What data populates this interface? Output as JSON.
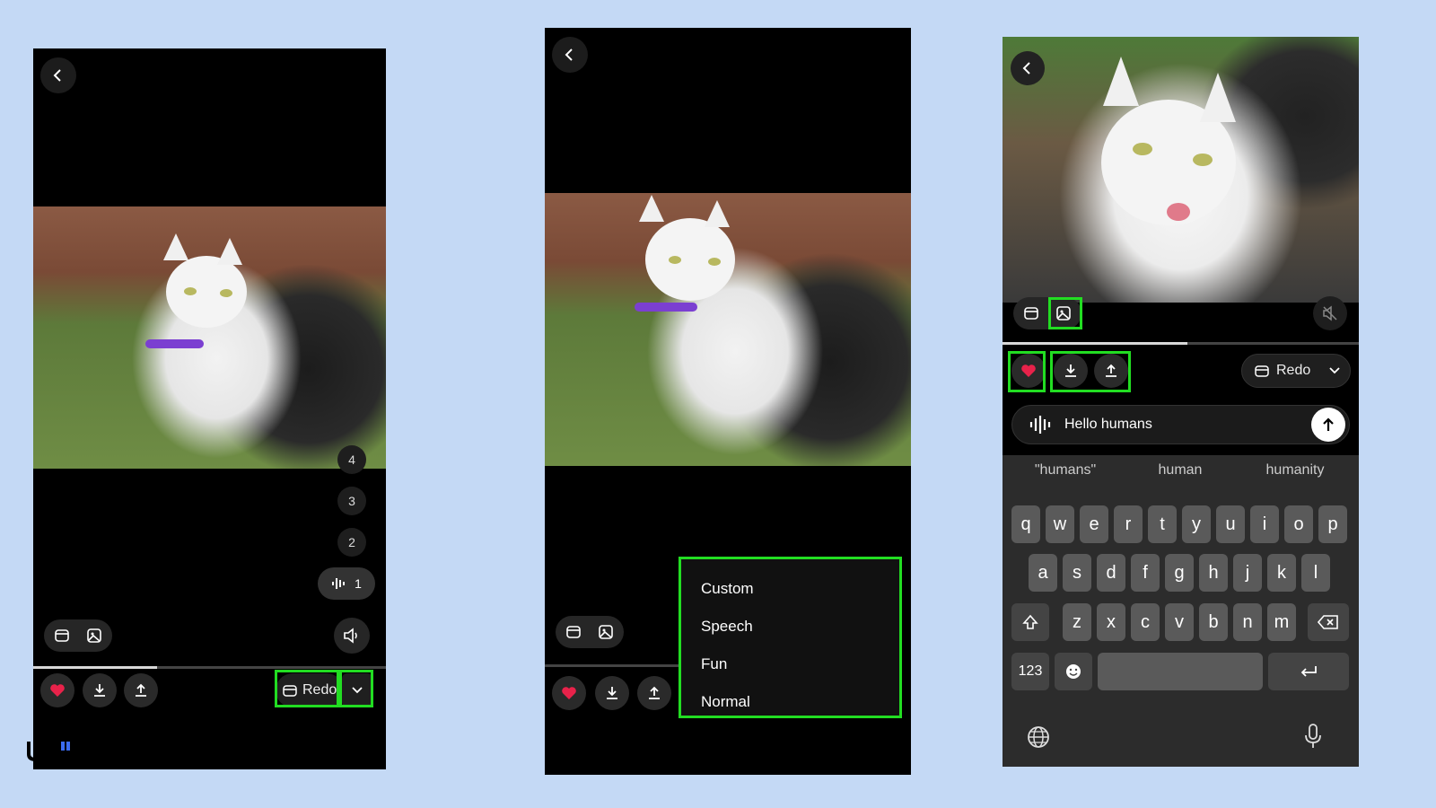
{
  "panel1": {
    "numbers": [
      "4",
      "3",
      "2",
      "1"
    ],
    "redo_label": "Redo",
    "progress": 0.35
  },
  "panel2": {
    "menu_items": [
      "Custom",
      "Speech",
      "Fun",
      "Normal"
    ]
  },
  "panel3": {
    "redo_label": "Redo",
    "input_text": "Hello humans",
    "suggestions": [
      "\"humans\"",
      "human",
      "humanity"
    ],
    "keyboard": {
      "row1": [
        "q",
        "w",
        "e",
        "r",
        "t",
        "y",
        "u",
        "i",
        "o",
        "p"
      ],
      "row2": [
        "a",
        "s",
        "d",
        "f",
        "g",
        "h",
        "j",
        "k",
        "l"
      ],
      "row3": [
        "z",
        "x",
        "c",
        "v",
        "b",
        "n",
        "m"
      ],
      "numbers_key": "123"
    },
    "progress": 0.52
  },
  "colors": {
    "background": "#c4d9f5",
    "highlight": "#22dd22",
    "heart": "#e8224a",
    "collar": "#7b3fd1"
  },
  "icons": [
    "back-chevron-icon",
    "heart-icon",
    "download-icon",
    "share-icon",
    "redo-icon",
    "chevron-down-icon",
    "clip-icon",
    "image-icon",
    "speaker-icon",
    "muted-speaker-icon",
    "waveform-icon",
    "send-arrow-icon",
    "shift-icon",
    "backspace-icon",
    "emoji-icon",
    "return-icon",
    "globe-icon",
    "mic-icon"
  ]
}
